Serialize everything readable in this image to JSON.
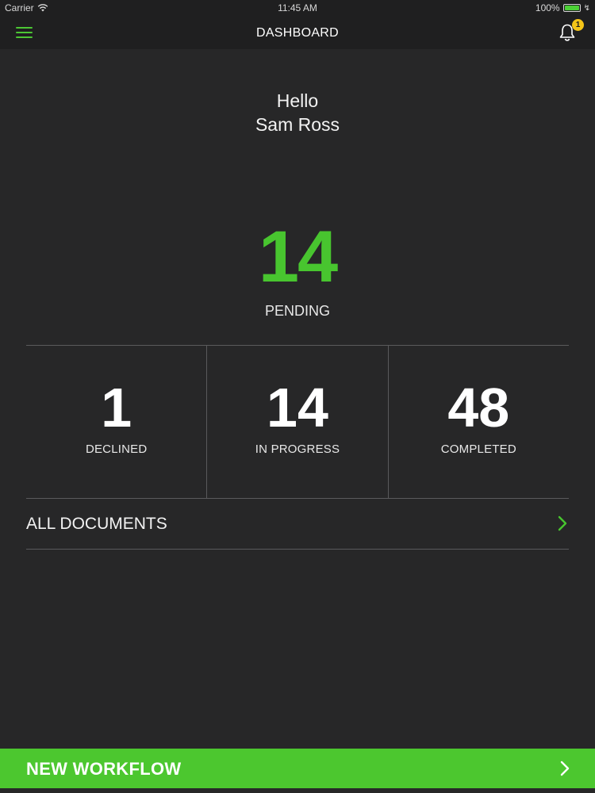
{
  "status_bar": {
    "carrier": "Carrier",
    "time": "11:45 AM",
    "battery": "100%",
    "battery_level": 1.0
  },
  "nav": {
    "title": "DASHBOARD",
    "notification_count": "1",
    "menu_icon": "hamburger-menu-icon",
    "bell_icon": "bell-icon"
  },
  "greeting": {
    "line1": "Hello",
    "line2": "Sam Ross"
  },
  "pending": {
    "count": "14",
    "label": "PENDING"
  },
  "stats": [
    {
      "value": "1",
      "label": "DECLINED"
    },
    {
      "value": "14",
      "label": "IN PROGRESS"
    },
    {
      "value": "48",
      "label": "COMPLETED"
    }
  ],
  "all_documents": {
    "label": "ALL DOCUMENTS"
  },
  "new_workflow": {
    "label": "NEW WORKFLOW"
  },
  "colors": {
    "background": "#272728",
    "bar": "#1f1f20",
    "accent": "#48c52f",
    "badge": "#f5c518",
    "divider": "#5a5a5c"
  }
}
